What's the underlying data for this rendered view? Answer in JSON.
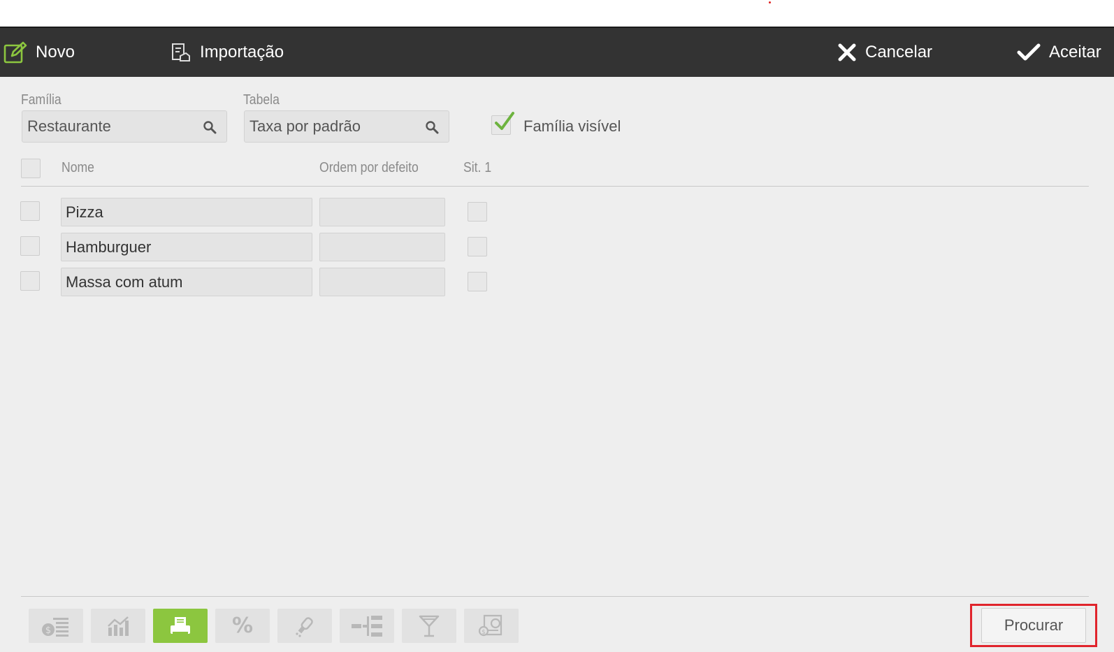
{
  "toolbar": {
    "new_label": "Novo",
    "import_label": "Importação",
    "cancel_label": "Cancelar",
    "accept_label": "Aceitar"
  },
  "filters": {
    "family_label": "Família",
    "family_value": "Restaurante",
    "table_label": "Tabela",
    "table_value": "Taxa por padrão",
    "family_visible_label": "Família visível",
    "family_visible_checked": true
  },
  "grid": {
    "columns": [
      "Nome",
      "Ordem por defeito",
      "Sit. 1"
    ],
    "rows": [
      {
        "name": "Pizza",
        "order": "",
        "sit1": false
      },
      {
        "name": "Hamburguer",
        "order": "",
        "sit1": false
      },
      {
        "name": "Massa com atum",
        "order": "",
        "sit1": false
      }
    ]
  },
  "bottom_tabs": [
    {
      "icon": "price-list-icon",
      "active": false
    },
    {
      "icon": "chart-icon",
      "active": false
    },
    {
      "icon": "printer-icon",
      "active": true
    },
    {
      "icon": "percent-icon",
      "active": false
    },
    {
      "icon": "seasoning-icon",
      "active": false
    },
    {
      "icon": "hierarchy-icon",
      "active": false
    },
    {
      "icon": "cocktail-icon",
      "active": false
    },
    {
      "icon": "receipt-settings-icon",
      "active": false
    }
  ],
  "search_button_label": "Procurar",
  "colors": {
    "toolbar_bg": "#333333",
    "accent_green": "#8cc63f",
    "highlight_red": "#e0242c"
  }
}
